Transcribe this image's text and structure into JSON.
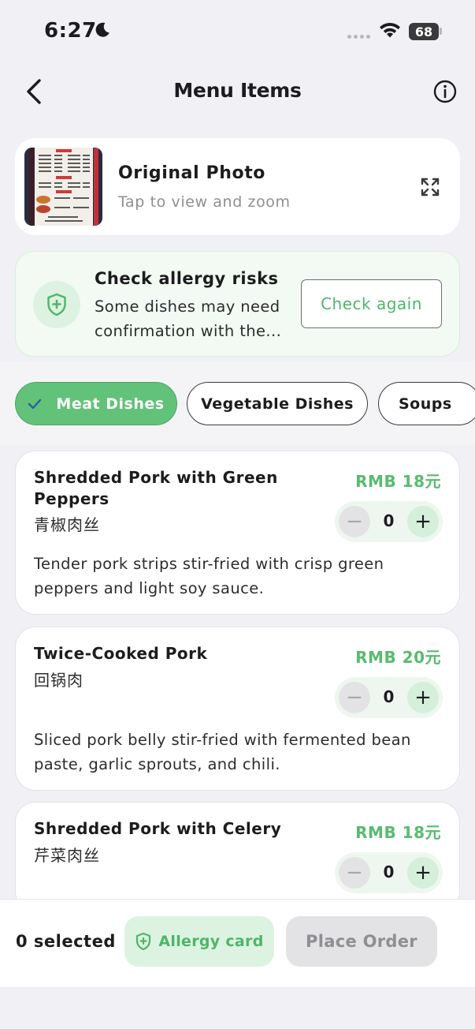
{
  "status_bar": {
    "time": "6:27",
    "battery": "68",
    "icons": [
      "moon-icon",
      "signal-dots-icon",
      "wifi-icon",
      "battery-icon"
    ]
  },
  "nav": {
    "title": "Menu Items",
    "back_icon": "chevron-left-icon",
    "info_icon": "info-circle-icon"
  },
  "photo_card": {
    "title": "Original Photo",
    "subtitle": "Tap to view and zoom",
    "expand_icon": "expand-icon"
  },
  "allergy": {
    "title": "Check allergy risks",
    "desc_line1": "Some dishes may need",
    "desc_line2": "confirmation with the...",
    "button": "Check again",
    "icon": "shield-plus-icon"
  },
  "tabs": [
    {
      "label": "Meat Dishes",
      "active": true
    },
    {
      "label": "Vegetable Dishes",
      "active": false
    },
    {
      "label": "Soups",
      "active": false
    }
  ],
  "dishes": [
    {
      "name_line1": "Shredded Pork with Green",
      "name_line2": "Peppers",
      "name_cn": "青椒肉丝",
      "price": "RMB 18元",
      "quantity": "0",
      "desc_line1": "Tender pork strips stir-fried with crisp green",
      "desc_line2": "peppers and light soy sauce."
    },
    {
      "name_line1": "Twice-Cooked Pork",
      "name_cn": "回锅肉",
      "price": "RMB 20元",
      "quantity": "0",
      "desc_line1": "Sliced pork belly stir-fried with fermented bean",
      "desc_line2": "paste, garlic sprouts, and chili."
    },
    {
      "name_line1": "Shredded Pork with Celery",
      "name_cn": "芹菜肉丝",
      "price": "RMB 18元",
      "quantity": "0"
    }
  ],
  "stepper": {
    "minus": "−",
    "plus": "+"
  },
  "bottom_bar": {
    "selected": "0 selected",
    "allergy_card": "Allergy card",
    "place_order": "Place Order"
  },
  "colors": {
    "accent_green": "#63c27a",
    "price_green": "#58bb70",
    "background": "#f1f1f5"
  }
}
